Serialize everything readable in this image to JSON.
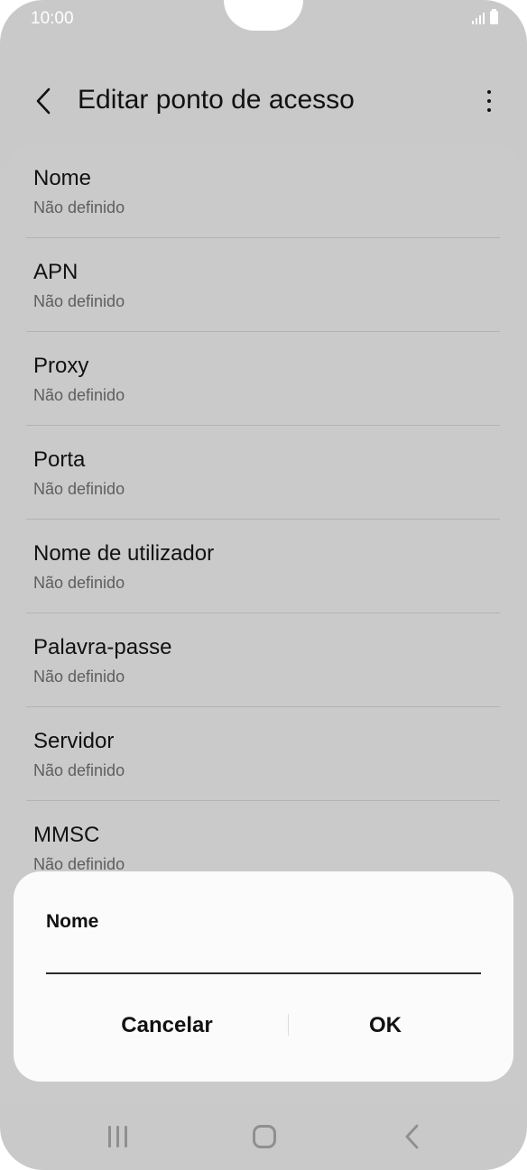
{
  "status_bar": {
    "time": "10:00",
    "icons": [
      "signal-icon",
      "battery-icon"
    ]
  },
  "app_bar": {
    "title": "Editar ponto de acesso",
    "back_icon": "back-chevron-icon",
    "more_icon": "more-options-icon"
  },
  "settings": [
    {
      "label": "Nome",
      "value": "Não definido"
    },
    {
      "label": "APN",
      "value": "Não definido"
    },
    {
      "label": "Proxy",
      "value": "Não definido"
    },
    {
      "label": "Porta",
      "value": "Não definido"
    },
    {
      "label": "Nome de utilizador",
      "value": "Não definido"
    },
    {
      "label": "Palavra-passe",
      "value": "Não definido"
    },
    {
      "label": "Servidor",
      "value": "Não definido"
    },
    {
      "label": "MMSC",
      "value": "Não definido"
    }
  ],
  "dialog": {
    "title": "Nome",
    "input_value": "",
    "cancel_label": "Cancelar",
    "ok_label": "OK"
  },
  "nav_bar": {
    "icons": [
      "recent-apps-icon",
      "home-icon",
      "back-icon"
    ]
  },
  "colors": {
    "screen_background": "#c9c9c9",
    "dialog_background": "#fbfbfb",
    "primary_text": "#111111",
    "secondary_text": "#5e5e5e"
  }
}
